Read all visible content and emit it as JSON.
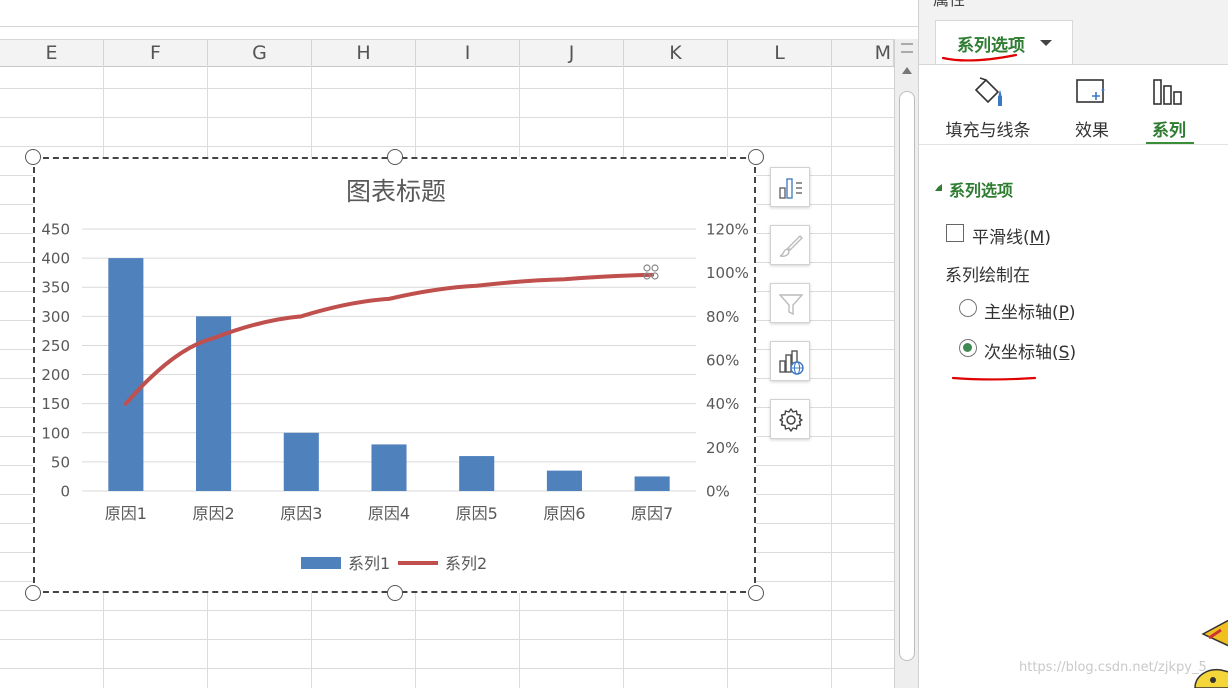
{
  "sheet": {
    "columns": [
      "E",
      "F",
      "G",
      "H",
      "I",
      "J",
      "K",
      "L",
      "M"
    ]
  },
  "chart_data": {
    "type": "bar",
    "title": "图表标题",
    "categories": [
      "原因1",
      "原因2",
      "原因3",
      "原因4",
      "原因5",
      "原因6",
      "原因7"
    ],
    "series": [
      {
        "name": "系列1",
        "type": "bar",
        "axis": "primary",
        "color": "#4f81bd",
        "values": [
          400,
          300,
          100,
          80,
          60,
          35,
          25
        ]
      },
      {
        "name": "系列2",
        "type": "line",
        "axis": "secondary",
        "color": "#c0504d",
        "values": [
          0.4,
          0.7,
          0.8,
          0.88,
          0.94,
          0.97,
          0.99
        ]
      }
    ],
    "y_primary": {
      "min": 0,
      "max": 450,
      "ticks": [
        "450",
        "400",
        "350",
        "300",
        "250",
        "200",
        "150",
        "100",
        "50",
        "0"
      ]
    },
    "y_secondary": {
      "min": 0,
      "max": 1.2,
      "ticks": [
        "120%",
        "100%",
        "80%",
        "60%",
        "40%",
        "20%",
        "0%"
      ]
    },
    "grid": true,
    "legend_position": "bottom"
  },
  "chart_tools": [
    "chart-elements-icon",
    "chart-style-icon",
    "chart-filter-icon",
    "chart-online-icon",
    "chart-settings-icon"
  ],
  "pane": {
    "title": "属性",
    "tab_label": "系列选项",
    "categories": [
      {
        "label": "填充与线条",
        "icon": "fill-bucket-icon"
      },
      {
        "label": "效果",
        "icon": "effects-icon"
      },
      {
        "label": "系列",
        "icon": "series-bars-icon",
        "active": true
      }
    ],
    "section_label": "系列选项",
    "smooth_label_prefix": "平滑线(",
    "smooth_key": "M",
    "smooth_checked": false,
    "plot_on_label": "系列绘制在",
    "primary_label_prefix": "主坐标轴(",
    "primary_key": "P",
    "secondary_label_prefix": "次坐标轴(",
    "secondary_key": "S",
    "selected_axis": "secondary",
    "close_paren": ")"
  },
  "watermark": "https://blog.csdn.net/zjkpy_5",
  "colors": {
    "accent_green": "#2e7d32",
    "annotation_red": "#e00000"
  }
}
